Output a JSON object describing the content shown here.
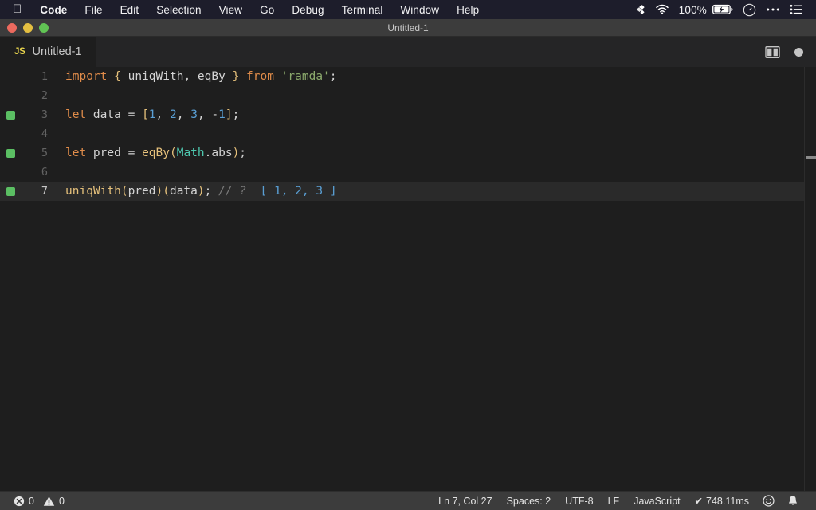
{
  "menubar": {
    "apple_icon": "apple-logo-icon",
    "items": [
      {
        "label": "Code",
        "bold": true
      },
      {
        "label": "File",
        "bold": false
      },
      {
        "label": "Edit",
        "bold": false
      },
      {
        "label": "Selection",
        "bold": false
      },
      {
        "label": "View",
        "bold": false
      },
      {
        "label": "Go",
        "bold": false
      },
      {
        "label": "Debug",
        "bold": false
      },
      {
        "label": "Terminal",
        "bold": false
      },
      {
        "label": "Window",
        "bold": false
      },
      {
        "label": "Help",
        "bold": false
      }
    ],
    "status": {
      "dropbox_icon": "dropbox-icon",
      "wifi_icon": "wifi-icon",
      "battery_percent": "100%",
      "battery_icon": "battery-charging-icon",
      "siri_icon": "siri-circle-icon",
      "more_icon": "ellipsis-icon",
      "control_center_icon": "control-center-icon"
    }
  },
  "window": {
    "title": "Untitled-1",
    "close_label": "close",
    "minimize_label": "minimize",
    "zoom_label": "zoom",
    "colors": {
      "close": "#ec6a5e",
      "minimize": "#e4bf41",
      "zoom": "#61c454"
    }
  },
  "tabbar": {
    "tab": {
      "badge": "JS",
      "label": "Untitled-1"
    },
    "actions": {
      "split_editor_icon": "split-editor-icon",
      "unsaved_dot": "unsaved-indicator-icon"
    }
  },
  "editor": {
    "language": "JavaScript",
    "lines": [
      {
        "number": "1",
        "marker": false,
        "current": false,
        "tokens": [
          {
            "text": "import",
            "cls": "t-kw"
          },
          {
            "text": " ",
            "cls": "t-punct"
          },
          {
            "text": "{",
            "cls": "t-brace"
          },
          {
            "text": " uniqWith",
            "cls": "t-ident"
          },
          {
            "text": ",",
            "cls": "t-punct"
          },
          {
            "text": " eqBy ",
            "cls": "t-ident"
          },
          {
            "text": "}",
            "cls": "t-brace"
          },
          {
            "text": " ",
            "cls": "t-punct"
          },
          {
            "text": "from",
            "cls": "t-from"
          },
          {
            "text": " ",
            "cls": "t-punct"
          },
          {
            "text": "'ramda'",
            "cls": "t-str"
          },
          {
            "text": ";",
            "cls": "t-semi"
          }
        ]
      },
      {
        "number": "2",
        "marker": false,
        "current": false,
        "tokens": []
      },
      {
        "number": "3",
        "marker": true,
        "current": false,
        "tokens": [
          {
            "text": "let",
            "cls": "t-kw"
          },
          {
            "text": " data ",
            "cls": "t-ident"
          },
          {
            "text": "=",
            "cls": "t-punct"
          },
          {
            "text": " ",
            "cls": "t-punct"
          },
          {
            "text": "[",
            "cls": "t-brace"
          },
          {
            "text": "1",
            "cls": "t-num"
          },
          {
            "text": ",",
            "cls": "t-punct"
          },
          {
            "text": " ",
            "cls": "t-punct"
          },
          {
            "text": "2",
            "cls": "t-num"
          },
          {
            "text": ",",
            "cls": "t-punct"
          },
          {
            "text": " ",
            "cls": "t-punct"
          },
          {
            "text": "3",
            "cls": "t-num"
          },
          {
            "text": ",",
            "cls": "t-punct"
          },
          {
            "text": " ",
            "cls": "t-punct"
          },
          {
            "text": "-",
            "cls": "t-punct"
          },
          {
            "text": "1",
            "cls": "t-num"
          },
          {
            "text": "]",
            "cls": "t-brace"
          },
          {
            "text": ";",
            "cls": "t-semi"
          }
        ]
      },
      {
        "number": "4",
        "marker": false,
        "current": false,
        "tokens": []
      },
      {
        "number": "5",
        "marker": true,
        "current": false,
        "tokens": [
          {
            "text": "let",
            "cls": "t-kw"
          },
          {
            "text": " pred ",
            "cls": "t-ident"
          },
          {
            "text": "=",
            "cls": "t-punct"
          },
          {
            "text": " ",
            "cls": "t-punct"
          },
          {
            "text": "eqBy",
            "cls": "t-fn"
          },
          {
            "text": "(",
            "cls": "t-paren"
          },
          {
            "text": "Math",
            "cls": "t-class"
          },
          {
            "text": ".abs",
            "cls": "t-ident"
          },
          {
            "text": ")",
            "cls": "t-paren"
          },
          {
            "text": ";",
            "cls": "t-semi"
          }
        ]
      },
      {
        "number": "6",
        "marker": false,
        "current": false,
        "tokens": []
      },
      {
        "number": "7",
        "marker": true,
        "current": true,
        "tokens": [
          {
            "text": "uniqWith",
            "cls": "t-fn"
          },
          {
            "text": "(",
            "cls": "t-paren"
          },
          {
            "text": "pred",
            "cls": "t-ident"
          },
          {
            "text": ")",
            "cls": "t-paren"
          },
          {
            "text": "(",
            "cls": "t-paren"
          },
          {
            "text": "data",
            "cls": "t-ident"
          },
          {
            "text": ")",
            "cls": "t-paren"
          },
          {
            "text": ";",
            "cls": "t-semi"
          },
          {
            "text": " ",
            "cls": "t-punct"
          },
          {
            "text": "// ?",
            "cls": "t-comment"
          },
          {
            "text": "  ",
            "cls": "t-punct"
          },
          {
            "text": "[",
            "cls": "t-bracket"
          },
          {
            "text": " ",
            "cls": "t-punct"
          },
          {
            "text": "1",
            "cls": "t-num"
          },
          {
            "text": ",",
            "cls": "t-num"
          },
          {
            "text": " ",
            "cls": "t-punct"
          },
          {
            "text": "2",
            "cls": "t-num"
          },
          {
            "text": ",",
            "cls": "t-num"
          },
          {
            "text": " ",
            "cls": "t-punct"
          },
          {
            "text": "3",
            "cls": "t-num"
          },
          {
            "text": " ",
            "cls": "t-punct"
          },
          {
            "text": "]",
            "cls": "t-bracket"
          }
        ]
      }
    ]
  },
  "statusbar": {
    "error_icon": "error-icon",
    "error_count": "0",
    "warning_icon": "warning-icon",
    "warning_count": "0",
    "cursor_position": "Ln 7, Col 27",
    "indentation": "Spaces: 2",
    "encoding": "UTF-8",
    "eol": "LF",
    "language_mode": "JavaScript",
    "quokka_check": "✔",
    "quokka_time": "748.11ms",
    "feedback_icon": "smiley-icon",
    "bell_icon": "bell-icon"
  }
}
